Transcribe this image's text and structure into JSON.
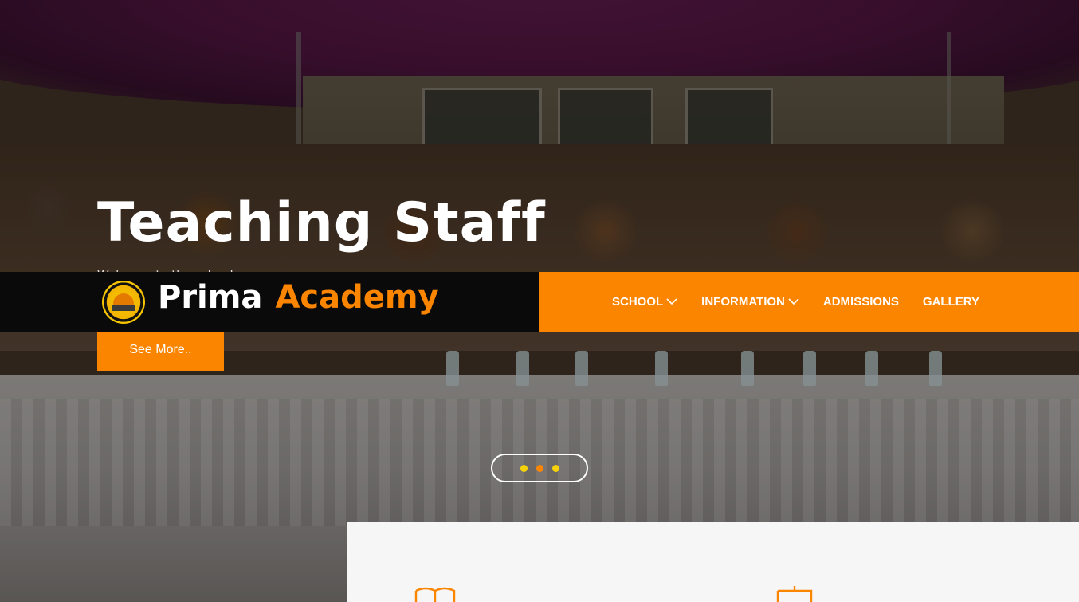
{
  "hero": {
    "title": "Teaching Staff",
    "subtitle": "Welcome to the school",
    "cta_label": "See More.."
  },
  "brand": {
    "name_part1": "Prima",
    "name_part2": "Academy",
    "logo_text": "PRIMA ACADEMY"
  },
  "nav": {
    "items": [
      {
        "label": "SCHOOL",
        "has_dropdown": true
      },
      {
        "label": "INFORMATION",
        "has_dropdown": true
      },
      {
        "label": "ADMISSIONS",
        "has_dropdown": false
      },
      {
        "label": "GALLERY",
        "has_dropdown": false
      }
    ]
  },
  "slider": {
    "slide_count": 3,
    "active_index": 1
  },
  "features": {
    "icons": [
      "book-icon",
      "easel-icon"
    ]
  },
  "colors": {
    "accent": "#fc8500",
    "nav_dark": "#0a0a0a",
    "dot_inactive": "#f6d20a",
    "card_bg": "#f6f6f6"
  }
}
